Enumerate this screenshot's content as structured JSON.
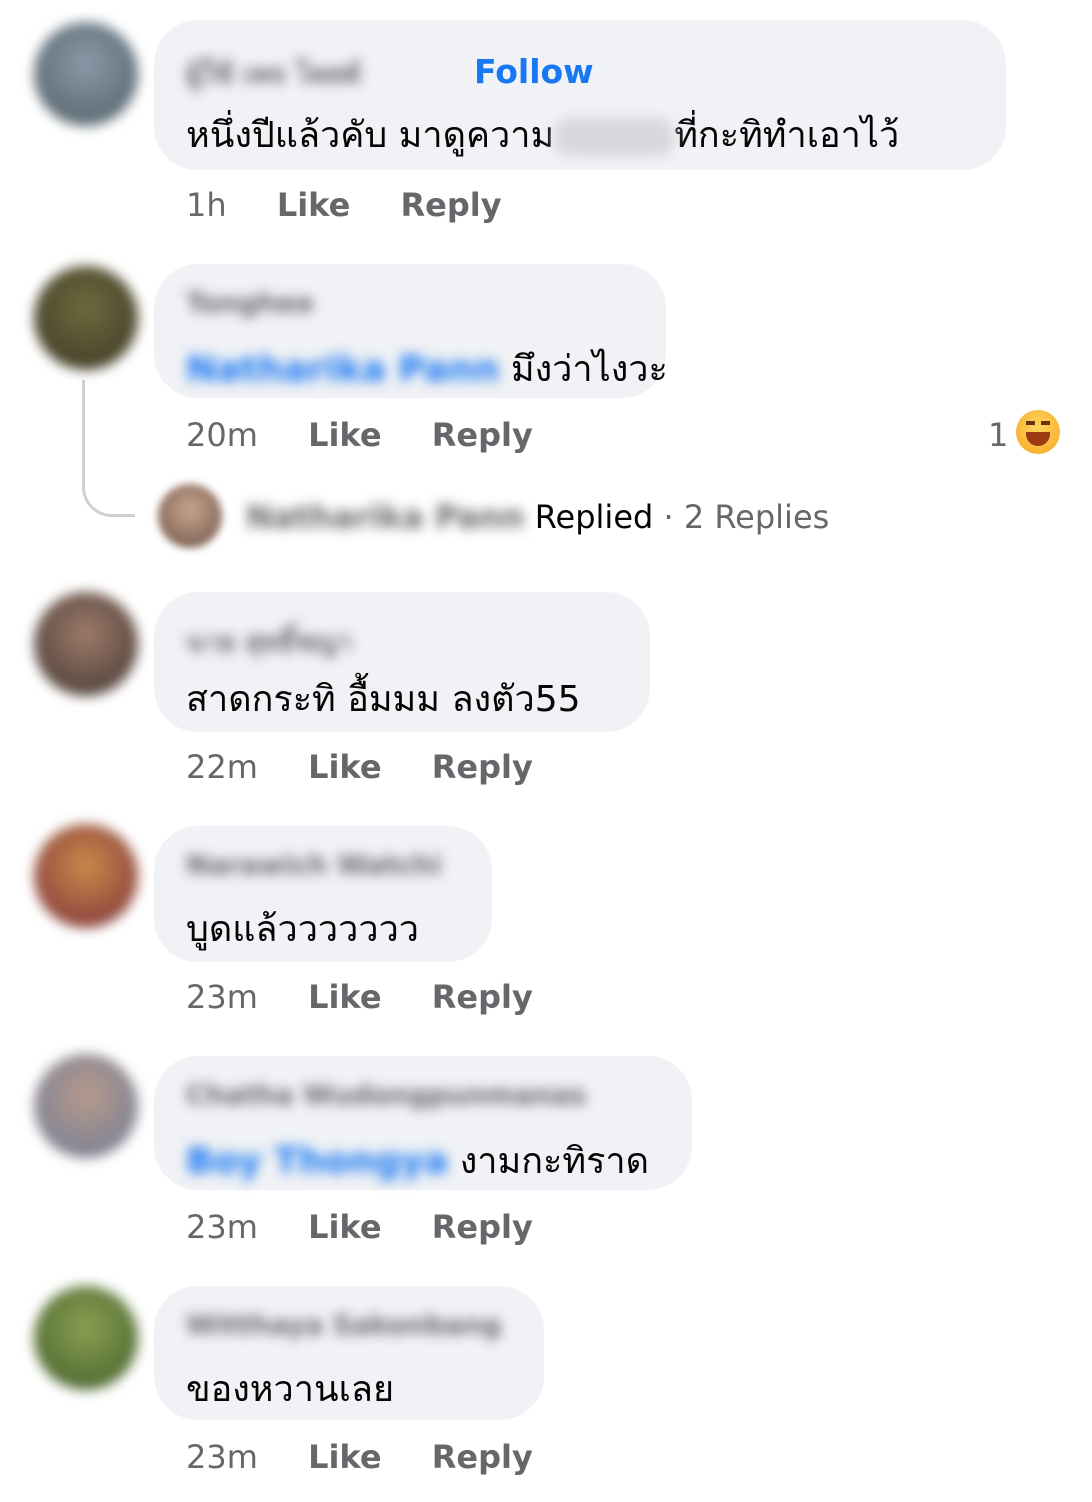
{
  "comments": [
    {
      "name": "ผู้ใช้ เพจ โพสต์",
      "follow": "Follow",
      "text_a": "หนึ่งปีแล้วคับ  มาดูความ",
      "text_b": "ที่กะทิทำเอาไว้",
      "time": "1h",
      "like": "Like",
      "reply": "Reply"
    },
    {
      "name": "Tonghee",
      "mention": "Natharika Pann",
      "text": "มึงว่าไงวะ",
      "time": "20m",
      "like": "Like",
      "reply": "Reply",
      "reaction_count": "1",
      "reaction_icon": "laughing-emoji-icon",
      "replied_name": "Natharika Pann",
      "replied_label": "Replied",
      "replies_count": "· 2 Replies"
    },
    {
      "name": "นาย สุทธิ์ชญา",
      "text": "สาดกระทิ อื้มมม ลงตัว55",
      "time": "22m",
      "like": "Like",
      "reply": "Reply"
    },
    {
      "name": "Narawich Watchi",
      "text": "บูดแล้ววววววว",
      "time": "23m",
      "like": "Like",
      "reply": "Reply"
    },
    {
      "name": "Chatha Wudongpunmanas",
      "mention": "Boy Thongya",
      "text": "งามกะทิราด",
      "time": "23m",
      "like": "Like",
      "reply": "Reply"
    },
    {
      "name": "Witthaya Sakonbang",
      "text": "ของหวานเลย",
      "time": "23m",
      "like": "Like",
      "reply": "Reply"
    }
  ],
  "colors": {
    "accent": "#1877f2",
    "bubble": "#f0f2f5",
    "meta": "#65676b"
  }
}
